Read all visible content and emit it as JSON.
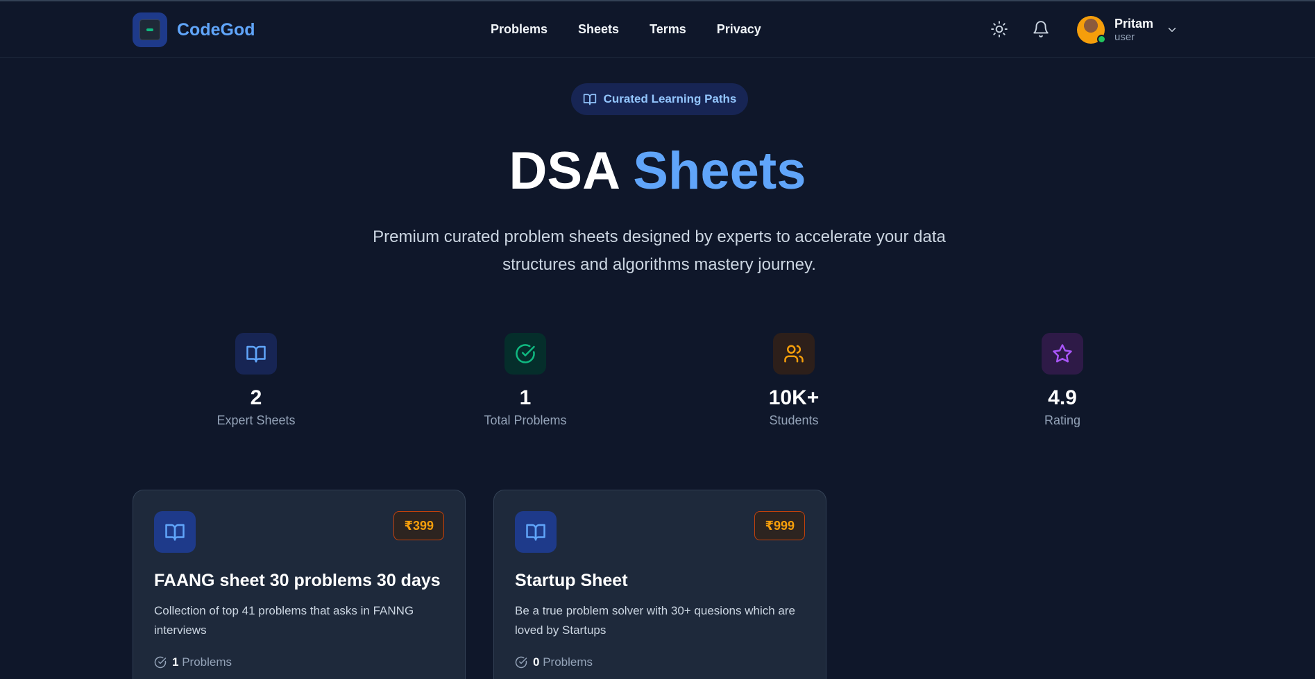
{
  "brand": {
    "name": "CodeGod",
    "logo_icon": "codegod-logo"
  },
  "nav": {
    "links": [
      "Problems",
      "Sheets",
      "Terms",
      "Privacy"
    ]
  },
  "header_icons": [
    "sun-icon",
    "bell-icon"
  ],
  "user": {
    "name": "Pritam",
    "role": "user",
    "status_color": "#22c55e"
  },
  "hero": {
    "badge": "Curated Learning Paths",
    "title_main": "DSA",
    "title_accent": "Sheets",
    "subtitle": "Premium curated problem sheets designed by experts to accelerate your data structures and algorithms mastery journey."
  },
  "stats": [
    {
      "value": "2",
      "label": "Expert Sheets",
      "icon": "book-open-icon",
      "color": "#60a5fa"
    },
    {
      "value": "1",
      "label": "Total Problems",
      "icon": "check-circle-icon",
      "color": "#10b981"
    },
    {
      "value": "10K+",
      "label": "Students",
      "icon": "users-icon",
      "color": "#f59e0b"
    },
    {
      "value": "4.9",
      "label": "Rating",
      "icon": "star-icon",
      "color": "#a855f7"
    }
  ],
  "sheets": [
    {
      "title": "FAANG sheet 30 problems 30 days",
      "description": "Collection of top 41 problems that asks in FANNG interviews",
      "price": "₹399",
      "problem_count": "1",
      "problems_label": "Problems"
    },
    {
      "title": "Startup Sheet",
      "description": "Be a true problem solver with 30+ quesions which are loved by Startups",
      "price": "₹999",
      "problem_count": "0",
      "problems_label": "Problems"
    }
  ],
  "colors": {
    "background": "#0f172a",
    "accent": "#60a5fa",
    "card": "#1e293b",
    "price": "#f59e0b"
  }
}
